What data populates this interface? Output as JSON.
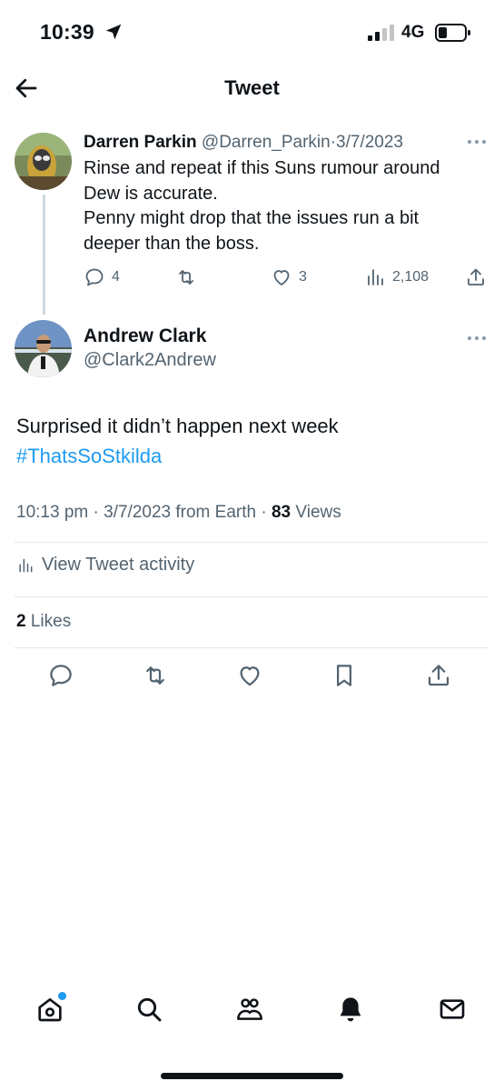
{
  "status_bar": {
    "time": "10:39",
    "network": "4G",
    "icons": [
      "location-arrow-icon",
      "signal-icon",
      "battery-icon"
    ]
  },
  "header": {
    "title": "Tweet",
    "back_icon": "back-arrow-icon"
  },
  "parent_tweet": {
    "author_name": "Darren Parkin",
    "handle": "@Darren_Parkin",
    "separator": "·",
    "date": "3/7/2023",
    "text_lines": [
      "Rinse and repeat if this Suns rumour around",
      "Dew is accurate.",
      "Penny might drop that the issues run a bit",
      "deeper than the boss."
    ],
    "reply_count": "4",
    "like_count": "3",
    "view_count": "2,108"
  },
  "main_tweet": {
    "author_name": "Andrew Clark",
    "handle": "@Clark2Andrew",
    "text": "Surprised it didn’t happen next week",
    "hashtag": "#ThatsSoStkilda",
    "time": "10:13 pm",
    "separator": "·",
    "date": "3/7/2023",
    "source": "from Earth",
    "views_count": "83",
    "views_label": "Views",
    "activity_label": "View Tweet activity",
    "likes_count": "2",
    "likes_label": "Likes"
  },
  "bottom_nav": {
    "items": [
      "home-icon",
      "search-icon",
      "communities-icon",
      "notifications-icon",
      "messages-icon"
    ]
  },
  "colors": {
    "accent": "#1d9bf0",
    "text": "#0f1419",
    "muted": "#536471",
    "divider": "#e1e8ed"
  }
}
